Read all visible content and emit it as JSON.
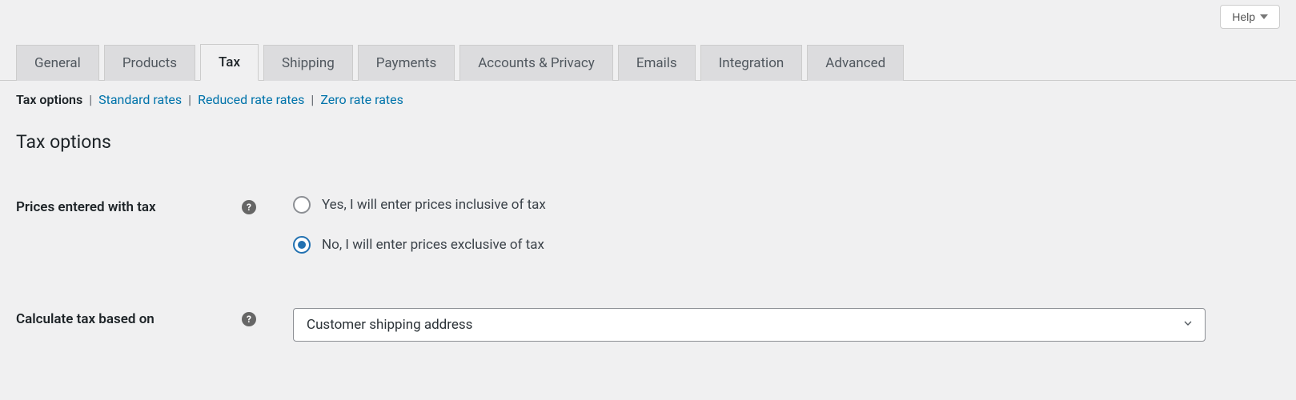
{
  "help_button": {
    "label": "Help"
  },
  "tabs": [
    {
      "label": "General"
    },
    {
      "label": "Products"
    },
    {
      "label": "Tax"
    },
    {
      "label": "Shipping"
    },
    {
      "label": "Payments"
    },
    {
      "label": "Accounts & Privacy"
    },
    {
      "label": "Emails"
    },
    {
      "label": "Integration"
    },
    {
      "label": "Advanced"
    }
  ],
  "subtabs": [
    {
      "label": "Tax options"
    },
    {
      "label": "Standard rates"
    },
    {
      "label": "Reduced rate rates"
    },
    {
      "label": "Zero rate rates"
    }
  ],
  "section_title": "Tax options",
  "rows": {
    "prices_entered": {
      "label": "Prices entered with tax",
      "options": [
        {
          "label": "Yes, I will enter prices inclusive of tax"
        },
        {
          "label": "No, I will enter prices exclusive of tax"
        }
      ]
    },
    "calculate_based": {
      "label": "Calculate tax based on",
      "selected": "Customer shipping address"
    }
  }
}
